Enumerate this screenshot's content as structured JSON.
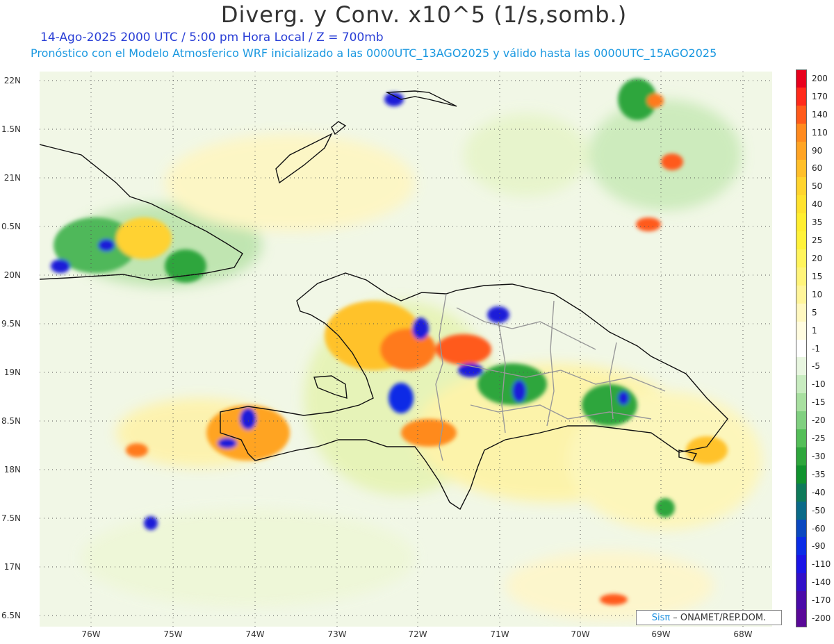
{
  "header": {
    "title": "Diverg. y Conv. x10^5 (1/s,somb.)",
    "subtitle_date": "14-Ago-2025  2000 UTC / 5:00 pm Hora Local / Z = 700mb",
    "subtitle_model": "Pronóstico con el Modelo Atmosferico WRF inicializado a las 0000UTC_13AGO2025 y válido hasta las  0000UTC_15AGO2025"
  },
  "axes": {
    "lat_labels": [
      "22N",
      "1.5N",
      "21N",
      "0.5N",
      "20N",
      "9.5N",
      "19N",
      "8.5N",
      "18N",
      "7.5N",
      "17N",
      "6.5N"
    ],
    "lon_labels": [
      "76W",
      "75W",
      "74W",
      "73W",
      "72W",
      "71W",
      "70W",
      "69W",
      "68W"
    ]
  },
  "colorbar": {
    "levels": [
      "200",
      "170",
      "140",
      "110",
      "90",
      "60",
      "50",
      "40",
      "35",
      "25",
      "20",
      "15",
      "10",
      "5",
      "1",
      "-1",
      "-5",
      "-10",
      "-15",
      "-20",
      "-25",
      "-30",
      "-35",
      "-40",
      "-50",
      "-60",
      "-90",
      "-110",
      "-140",
      "-170",
      "-200"
    ],
    "colors": [
      "#e8001c",
      "#ff2a1a",
      "#ff5a1a",
      "#ff8a1e",
      "#ffa424",
      "#ffbf2a",
      "#ffd42e",
      "#ffe22e",
      "#ffee30",
      "#fff23a",
      "#fff45c",
      "#fff47a",
      "#fff59a",
      "#fff8c0",
      "#fffce0",
      "#ffffff",
      "#e8f6e0",
      "#c8ecc0",
      "#a8e0a0",
      "#80d080",
      "#54be58",
      "#2ea63c",
      "#10922e",
      "#0e7a5a",
      "#0a6a88",
      "#0a48c0",
      "#0a2ce6",
      "#1a14e6",
      "#3210c8",
      "#4a0aa8",
      "#5a0898"
    ]
  },
  "credit": {
    "logo": "Sisπ",
    "text": "– ONAMET/REP.DOM."
  },
  "map": {
    "region": "Hispaniola and surrounding Caribbean"
  }
}
